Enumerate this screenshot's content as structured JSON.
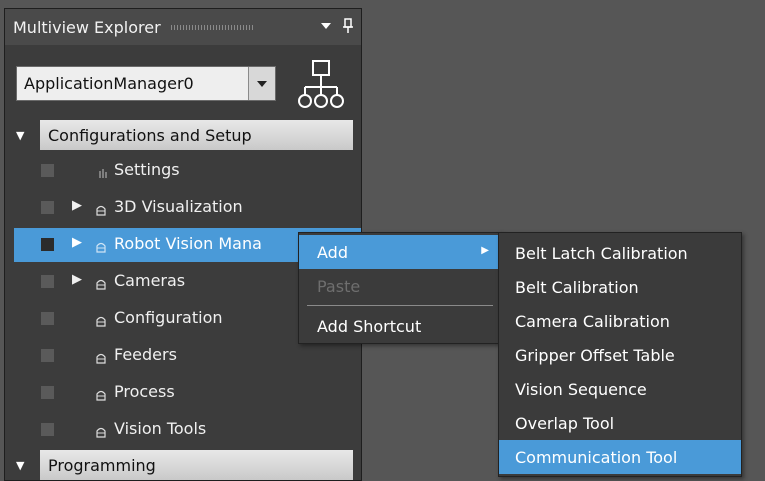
{
  "explorer": {
    "title": "Multiview Explorer",
    "combo_value": "ApplicationManager0"
  },
  "tree": {
    "sections": [
      {
        "label": "Configurations and Setup",
        "expanded": true
      },
      {
        "label": "Programming",
        "expanded": true
      }
    ],
    "items": [
      {
        "label": "Settings",
        "expandable": false,
        "icon": "settings-icon",
        "selected": false
      },
      {
        "label": "3D Visualization",
        "expandable": true,
        "icon": "node-icon",
        "selected": false
      },
      {
        "label": "Robot Vision Mana",
        "expandable": true,
        "icon": "node-icon",
        "selected": true
      },
      {
        "label": "Cameras",
        "expandable": true,
        "icon": "node-icon",
        "selected": false
      },
      {
        "label": "Configuration",
        "expandable": false,
        "icon": "node-icon",
        "selected": false
      },
      {
        "label": "Feeders",
        "expandable": false,
        "icon": "node-icon",
        "selected": false
      },
      {
        "label": "Process",
        "expandable": false,
        "icon": "node-icon",
        "selected": false
      },
      {
        "label": "Vision Tools",
        "expandable": false,
        "icon": "node-icon",
        "selected": false
      }
    ]
  },
  "context_menu": {
    "items": [
      {
        "label": "Add",
        "has_submenu": true,
        "highlighted": true,
        "enabled": true
      },
      {
        "label": "Paste",
        "has_submenu": false,
        "highlighted": false,
        "enabled": false
      },
      {
        "label": "Add Shortcut",
        "has_submenu": false,
        "highlighted": false,
        "enabled": true
      }
    ]
  },
  "submenu": {
    "items": [
      {
        "label": "Belt Latch Calibration",
        "highlighted": false
      },
      {
        "label": "Belt Calibration",
        "highlighted": false
      },
      {
        "label": "Camera Calibration",
        "highlighted": false
      },
      {
        "label": "Gripper Offset Table",
        "highlighted": false
      },
      {
        "label": "Vision Sequence",
        "highlighted": false
      },
      {
        "label": "Overlap Tool",
        "highlighted": false
      },
      {
        "label": "Communication Tool",
        "highlighted": true
      }
    ]
  },
  "colors": {
    "selection": "#4a9ad8",
    "panel": "#3c3c3c",
    "workspace": "#565656"
  }
}
